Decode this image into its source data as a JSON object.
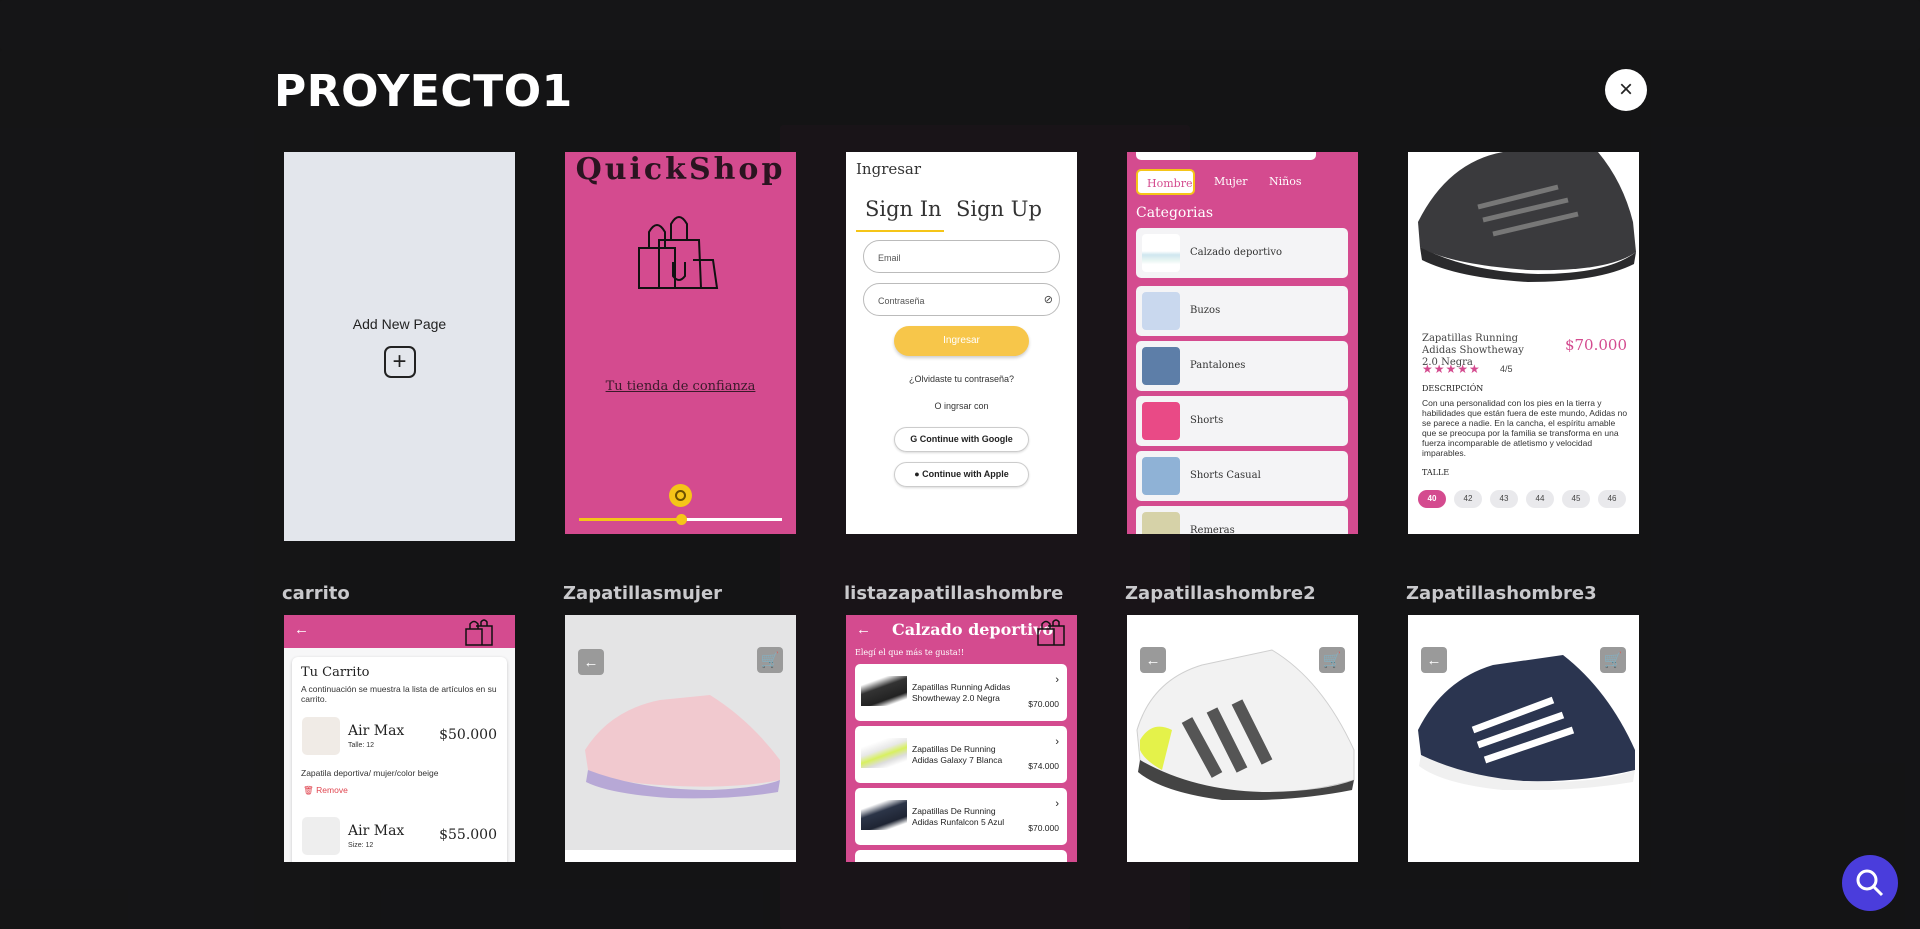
{
  "modal": {
    "title": "PROYECTO1",
    "close_label": "×"
  },
  "pages_row1": {
    "add_new": {
      "label": "Add New Page",
      "plus": "+"
    },
    "quickshop": {
      "title": "QuickShop",
      "tagline": "Tu tienda de confianza",
      "slider_value": 0.5
    },
    "signin": {
      "header": "Ingresar",
      "tab_signin": "Sign In",
      "tab_signup": "Sign Up",
      "email_placeholder": "Email",
      "password_placeholder": "Contraseña",
      "login_button": "Ingresar",
      "forgot": "¿Olvidaste tu contraseña?",
      "or": "O ingrsar con",
      "google": "Continue with Google",
      "apple": "Continue with Apple"
    },
    "categories": {
      "pills": [
        "Hombre",
        "Mujer",
        "Niños"
      ],
      "heading": "Categorias",
      "rows": [
        "Calzado deportivo",
        "Buzos",
        "Pantalones",
        "Shorts",
        "Shorts Casual",
        "Remeras"
      ]
    },
    "detail": {
      "name": "Zapatillas Running Adidas Showtheway 2.0 Negra",
      "price": "$70.000",
      "stars": "★★★★★",
      "rating": "4/5",
      "desc_label": "DESCRIPCIÓN",
      "description": "Con una personalidad con los pies en la tierra y habilidades que están fuera de este mundo, Adidas no se parece a nadie. En la cancha, el espíritu amable que se preocupa por la familia se transforma en una fuerza incomparable de atletismo y velocidad imparables.",
      "size_label": "TALLE",
      "sizes": [
        "40",
        "42",
        "43",
        "44",
        "45",
        "46"
      ]
    }
  },
  "pages_row2": {
    "labels": [
      "carrito",
      "Zapatillasmujer",
      "listazapatillashombre",
      "Zapatillashombre2",
      "Zapatillashombre3"
    ],
    "carrito": {
      "title": "Tu Carrito",
      "subtitle": "A continuación se muestra la lista de artículos en su carrito.",
      "item1_name": "Air Max",
      "item1_size": "Talle: 12",
      "item1_price": "$50.000",
      "item1_desc": "Zapatila deportiva/ mujer/color beige",
      "remove": "Remove",
      "item2_name": "Air Max",
      "item2_size": "Size: 12",
      "item2_price": "$55.000"
    },
    "lista": {
      "title": "Calzado deportivo",
      "subtitle": "Elegí el que más te gusta!!",
      "items": [
        {
          "name": "Zapatillas Running Adidas Showtheway 2.0 Negra",
          "price": "$70.000"
        },
        {
          "name": "Zapatillas De Running Adidas Galaxy 7 Blanca",
          "price": "$74.000"
        },
        {
          "name": "Zapatillas De Running Adidas Runfalcon 5 Azul",
          "price": "$70.000"
        }
      ]
    }
  },
  "colors": {
    "accent": "#d44b8f",
    "yellow": "#f5c518",
    "fab": "#4a3ddc"
  }
}
